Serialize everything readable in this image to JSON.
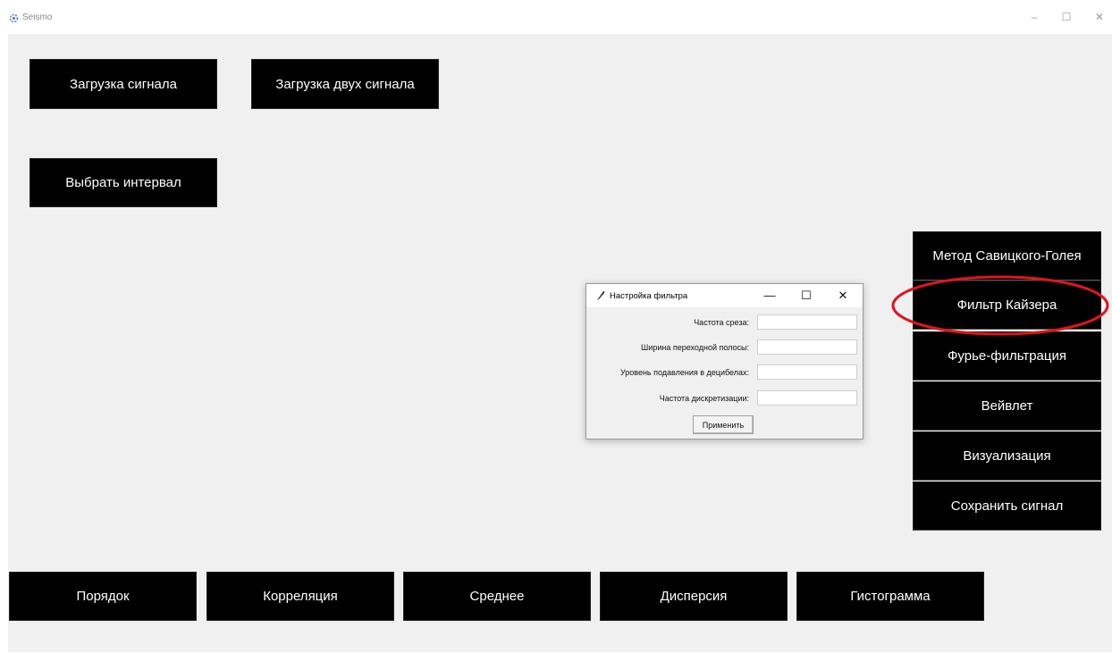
{
  "window": {
    "title": "Seismo",
    "minimize_glyph": "–",
    "maximize_glyph": "☐",
    "close_glyph": "✕"
  },
  "toolbar": {
    "load_signal": "Загрузка сигнала",
    "load_two_signals": "Загрузка двух сигнала",
    "select_interval": "Выбрать интервал"
  },
  "side_menu": [
    {
      "label": "Метод Савицкого-Голея"
    },
    {
      "label": "Фильтр Кайзера"
    },
    {
      "label": "Фурье-фильтрация"
    },
    {
      "label": "Вейвлет"
    },
    {
      "label": "Визуализация"
    },
    {
      "label": "Сохранить сигнал"
    }
  ],
  "bottom_bar": [
    {
      "label": "Порядок"
    },
    {
      "label": "Корреляция"
    },
    {
      "label": "Среднее"
    },
    {
      "label": "Дисперсия"
    },
    {
      "label": "Гистограмма"
    }
  ],
  "dialog": {
    "title": "Настройка фильтра",
    "minimize_glyph": "—",
    "maximize_glyph": "☐",
    "close_glyph": "✕",
    "fields": [
      {
        "label": "Частота среза:",
        "value": ""
      },
      {
        "label": "Ширина переходной полосы:",
        "value": ""
      },
      {
        "label": "Уровень подавления в децибелах:",
        "value": ""
      },
      {
        "label": "Частота дискретизации:",
        "value": ""
      }
    ],
    "apply_label": "Применить"
  },
  "highlight": {
    "color": "#e0141e",
    "target": "Фильтр Кайзера"
  },
  "icons": {
    "app": "settings-gears-icon",
    "dialog": "feather-icon"
  }
}
